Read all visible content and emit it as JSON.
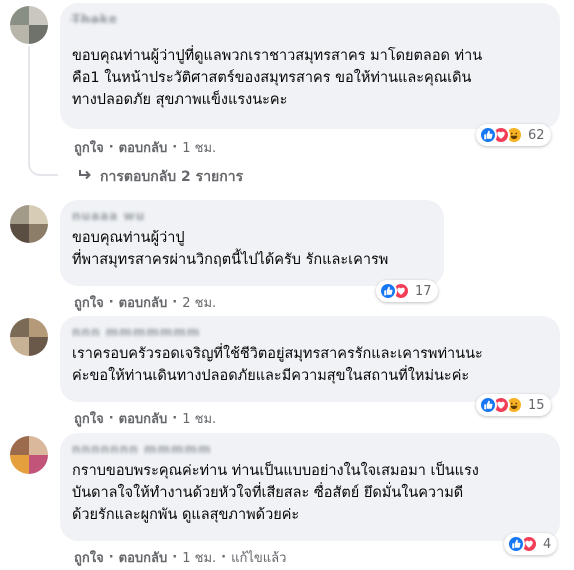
{
  "comments": [
    {
      "author": "T̶h̶a̶k̶e",
      "text": "ขอบคุณท่านผู้ว่าปูที่ดูแลพวกเราชาวสมุทรสาคร มาโดยตลอด ท่าน\nคือ1 ในหน้าประวัติศาสตร์ของสมุทรสาคร ขอให้ท่านและคุณเดิน\nทางปลอดภัย สุขภาพแข็งแรงนะคะ",
      "reaction_count": "62",
      "reactions": [
        "like",
        "love",
        "haha"
      ],
      "like_label": "ถูกใจ",
      "reply_label": "ตอบกลับ",
      "time": "1 ชม.",
      "replies_label": "การตอบกลับ 2 รายการ"
    },
    {
      "author": "nuaaa wu",
      "text": "ขอบคุณท่านผู้ว่าปู\nที่พาสมุทรสาครผ่านวิกฤตนี้ไปได้ครับ รักและเคารพ",
      "reaction_count": "17",
      "reactions": [
        "like",
        "love"
      ],
      "like_label": "ถูกใจ",
      "reply_label": "ตอบกลับ",
      "time": "2 ชม."
    },
    {
      "author": "nnn mmmmmmm",
      "text": "เราครอบครัวรอดเจริญที่ใช้ชีวิตอยู่สมุทรสาครรักและเคารพท่านนะ\nค่ะขอให้ท่านเดินทางปลอดภัยและมีความสุขในสถานที่ใหม่นะค่ะ",
      "reaction_count": "15",
      "reactions": [
        "like",
        "love",
        "haha"
      ],
      "like_label": "ถูกใจ",
      "reply_label": "ตอบกลับ",
      "time": "1 ชม."
    },
    {
      "author": "nnnnnnn mmmmm",
      "text": "กราบขอบพระคุณค่ะท่าน ท่านเป็นแบบอย่างในใจเสมอมา เป็นแรง\nบันดาลใจให้ทำงานด้วยหัวใจที่เสียสละ ซื่อสัตย์ ยึดมั่นในความดี\nด้วยรักและผูกพัน ดูแลสุขภาพด้วยค่ะ",
      "reaction_count": "4",
      "reactions": [
        "like",
        "love"
      ],
      "like_label": "ถูกใจ",
      "reply_label": "ตอบกลับ",
      "time": "1 ชม.",
      "edited_label": "แก้ไขแล้ว"
    }
  ],
  "colors": {
    "bubble": "#f0f2f5",
    "action_text": "#65676b",
    "like": "#1877f2",
    "love": "#f33e58",
    "haha": "#f7b125"
  },
  "icons": {
    "like": "thumbs-up-icon",
    "love": "heart-icon",
    "haha": "laughing-face-icon",
    "reply_arrow": "reply-arrow-icon"
  }
}
